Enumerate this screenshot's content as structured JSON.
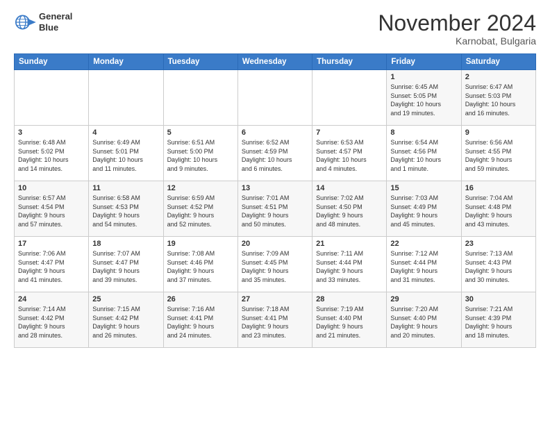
{
  "header": {
    "logo_line1": "General",
    "logo_line2": "Blue",
    "month": "November 2024",
    "location": "Karnobat, Bulgaria"
  },
  "weekdays": [
    "Sunday",
    "Monday",
    "Tuesday",
    "Wednesday",
    "Thursday",
    "Friday",
    "Saturday"
  ],
  "weeks": [
    [
      {
        "day": "",
        "info": ""
      },
      {
        "day": "",
        "info": ""
      },
      {
        "day": "",
        "info": ""
      },
      {
        "day": "",
        "info": ""
      },
      {
        "day": "",
        "info": ""
      },
      {
        "day": "1",
        "info": "Sunrise: 6:45 AM\nSunset: 5:05 PM\nDaylight: 10 hours\nand 19 minutes."
      },
      {
        "day": "2",
        "info": "Sunrise: 6:47 AM\nSunset: 5:03 PM\nDaylight: 10 hours\nand 16 minutes."
      }
    ],
    [
      {
        "day": "3",
        "info": "Sunrise: 6:48 AM\nSunset: 5:02 PM\nDaylight: 10 hours\nand 14 minutes."
      },
      {
        "day": "4",
        "info": "Sunrise: 6:49 AM\nSunset: 5:01 PM\nDaylight: 10 hours\nand 11 minutes."
      },
      {
        "day": "5",
        "info": "Sunrise: 6:51 AM\nSunset: 5:00 PM\nDaylight: 10 hours\nand 9 minutes."
      },
      {
        "day": "6",
        "info": "Sunrise: 6:52 AM\nSunset: 4:59 PM\nDaylight: 10 hours\nand 6 minutes."
      },
      {
        "day": "7",
        "info": "Sunrise: 6:53 AM\nSunset: 4:57 PM\nDaylight: 10 hours\nand 4 minutes."
      },
      {
        "day": "8",
        "info": "Sunrise: 6:54 AM\nSunset: 4:56 PM\nDaylight: 10 hours\nand 1 minute."
      },
      {
        "day": "9",
        "info": "Sunrise: 6:56 AM\nSunset: 4:55 PM\nDaylight: 9 hours\nand 59 minutes."
      }
    ],
    [
      {
        "day": "10",
        "info": "Sunrise: 6:57 AM\nSunset: 4:54 PM\nDaylight: 9 hours\nand 57 minutes."
      },
      {
        "day": "11",
        "info": "Sunrise: 6:58 AM\nSunset: 4:53 PM\nDaylight: 9 hours\nand 54 minutes."
      },
      {
        "day": "12",
        "info": "Sunrise: 6:59 AM\nSunset: 4:52 PM\nDaylight: 9 hours\nand 52 minutes."
      },
      {
        "day": "13",
        "info": "Sunrise: 7:01 AM\nSunset: 4:51 PM\nDaylight: 9 hours\nand 50 minutes."
      },
      {
        "day": "14",
        "info": "Sunrise: 7:02 AM\nSunset: 4:50 PM\nDaylight: 9 hours\nand 48 minutes."
      },
      {
        "day": "15",
        "info": "Sunrise: 7:03 AM\nSunset: 4:49 PM\nDaylight: 9 hours\nand 45 minutes."
      },
      {
        "day": "16",
        "info": "Sunrise: 7:04 AM\nSunset: 4:48 PM\nDaylight: 9 hours\nand 43 minutes."
      }
    ],
    [
      {
        "day": "17",
        "info": "Sunrise: 7:06 AM\nSunset: 4:47 PM\nDaylight: 9 hours\nand 41 minutes."
      },
      {
        "day": "18",
        "info": "Sunrise: 7:07 AM\nSunset: 4:47 PM\nDaylight: 9 hours\nand 39 minutes."
      },
      {
        "day": "19",
        "info": "Sunrise: 7:08 AM\nSunset: 4:46 PM\nDaylight: 9 hours\nand 37 minutes."
      },
      {
        "day": "20",
        "info": "Sunrise: 7:09 AM\nSunset: 4:45 PM\nDaylight: 9 hours\nand 35 minutes."
      },
      {
        "day": "21",
        "info": "Sunrise: 7:11 AM\nSunset: 4:44 PM\nDaylight: 9 hours\nand 33 minutes."
      },
      {
        "day": "22",
        "info": "Sunrise: 7:12 AM\nSunset: 4:44 PM\nDaylight: 9 hours\nand 31 minutes."
      },
      {
        "day": "23",
        "info": "Sunrise: 7:13 AM\nSunset: 4:43 PM\nDaylight: 9 hours\nand 30 minutes."
      }
    ],
    [
      {
        "day": "24",
        "info": "Sunrise: 7:14 AM\nSunset: 4:42 PM\nDaylight: 9 hours\nand 28 minutes."
      },
      {
        "day": "25",
        "info": "Sunrise: 7:15 AM\nSunset: 4:42 PM\nDaylight: 9 hours\nand 26 minutes."
      },
      {
        "day": "26",
        "info": "Sunrise: 7:16 AM\nSunset: 4:41 PM\nDaylight: 9 hours\nand 24 minutes."
      },
      {
        "day": "27",
        "info": "Sunrise: 7:18 AM\nSunset: 4:41 PM\nDaylight: 9 hours\nand 23 minutes."
      },
      {
        "day": "28",
        "info": "Sunrise: 7:19 AM\nSunset: 4:40 PM\nDaylight: 9 hours\nand 21 minutes."
      },
      {
        "day": "29",
        "info": "Sunrise: 7:20 AM\nSunset: 4:40 PM\nDaylight: 9 hours\nand 20 minutes."
      },
      {
        "day": "30",
        "info": "Sunrise: 7:21 AM\nSunset: 4:39 PM\nDaylight: 9 hours\nand 18 minutes."
      }
    ]
  ]
}
